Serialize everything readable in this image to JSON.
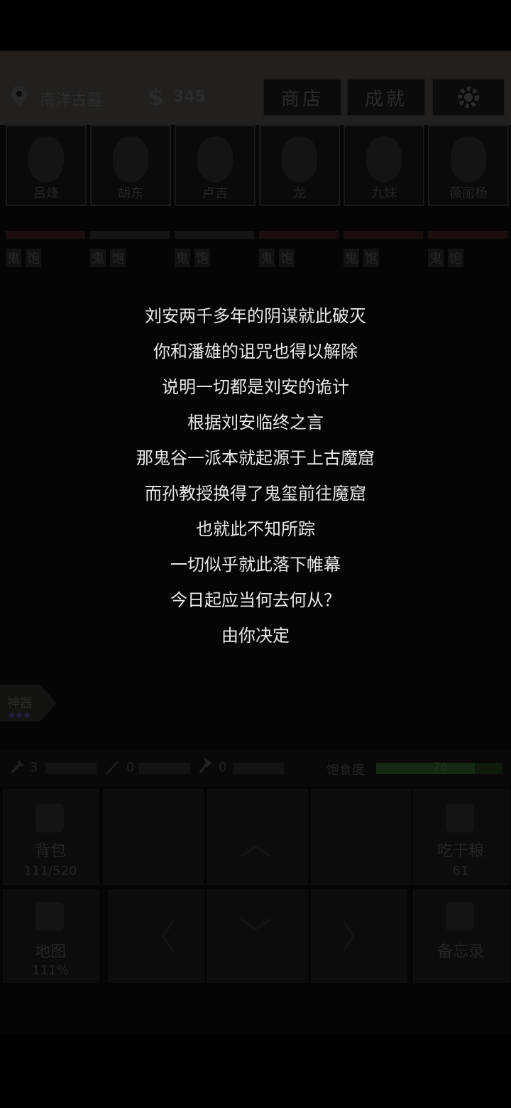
{
  "header": {
    "location": "南洋古墓",
    "money": "345",
    "shop_label": "商店",
    "achievement_label": "成就"
  },
  "characters": [
    {
      "name": "吕烽",
      "tag1": "鬼",
      "tag2": "饱"
    },
    {
      "name": "胡东",
      "tag1": "鬼",
      "tag2": "饱"
    },
    {
      "name": "卢吉",
      "tag1": "鬼",
      "tag2": "饱"
    },
    {
      "name": "龙",
      "tag1": "鬼",
      "tag2": "饱"
    },
    {
      "name": "九妹",
      "tag1": "鬼",
      "tag2": "饱"
    },
    {
      "name": "薇丽杨",
      "tag1": "鬼",
      "tag2": "饱"
    }
  ],
  "story": [
    "刘安两千多年的阴谋就此破灭",
    "你和潘雄的诅咒也得以解除",
    "说明一切都是刘安的诡计",
    "根据刘安临终之言",
    "那鬼谷一派本就起源于上古魔窟",
    "而孙教授换得了鬼玺前往魔窟",
    "也就此不知所踪",
    "一切似乎就此落下帷幕",
    "今日起应当何去何从？",
    "由你决定"
  ],
  "artifact_label": "神器",
  "resources": {
    "item1": "3",
    "item2": "0",
    "item3": "0",
    "satiety_label": "饱食度",
    "satiety_value": "78"
  },
  "bottom": {
    "backpack_label": "背包",
    "backpack_count": "111/520",
    "ration_label": "吃干粮",
    "ration_count": "61",
    "map_label": "地图",
    "map_percent": "111%",
    "memo_label": "备忘录"
  }
}
